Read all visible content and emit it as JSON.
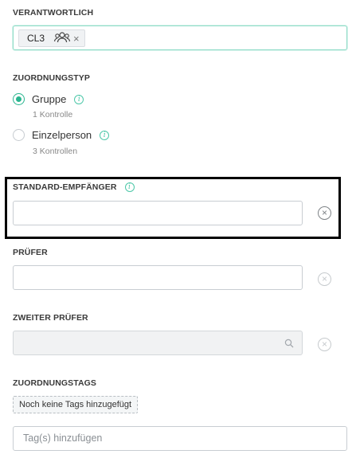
{
  "responsible": {
    "label": "VERANTWORTLICH",
    "chip_text": "CL3",
    "chip_icon": "group-icon",
    "chip_remove": "×"
  },
  "assignment_type": {
    "label": "ZUORDNUNGSTYP",
    "options": [
      {
        "label": "Gruppe",
        "sub": "1 Kontrolle",
        "selected": true
      },
      {
        "label": "Einzelperson",
        "sub": "3 Kontrollen",
        "selected": false
      }
    ],
    "info_glyph": "i"
  },
  "default_recipient": {
    "label": "STANDARD-EMPFÄNGER",
    "value": "",
    "clear_glyph": "×"
  },
  "reviewer": {
    "label": "PRÜFER",
    "value": "",
    "clear_glyph": "×"
  },
  "second_reviewer": {
    "label": "ZWEITER PRÜFER",
    "value": "",
    "clear_glyph": "×"
  },
  "assignment_tags": {
    "label": "ZUORDNUNGSTAGS",
    "empty_text": "Noch keine Tags hinzugefügt",
    "input_placeholder": "Tag(s) hinzufügen"
  },
  "colors": {
    "accent": "#2ab58f",
    "info": "#4cc7a8",
    "highlight": "#000000"
  }
}
